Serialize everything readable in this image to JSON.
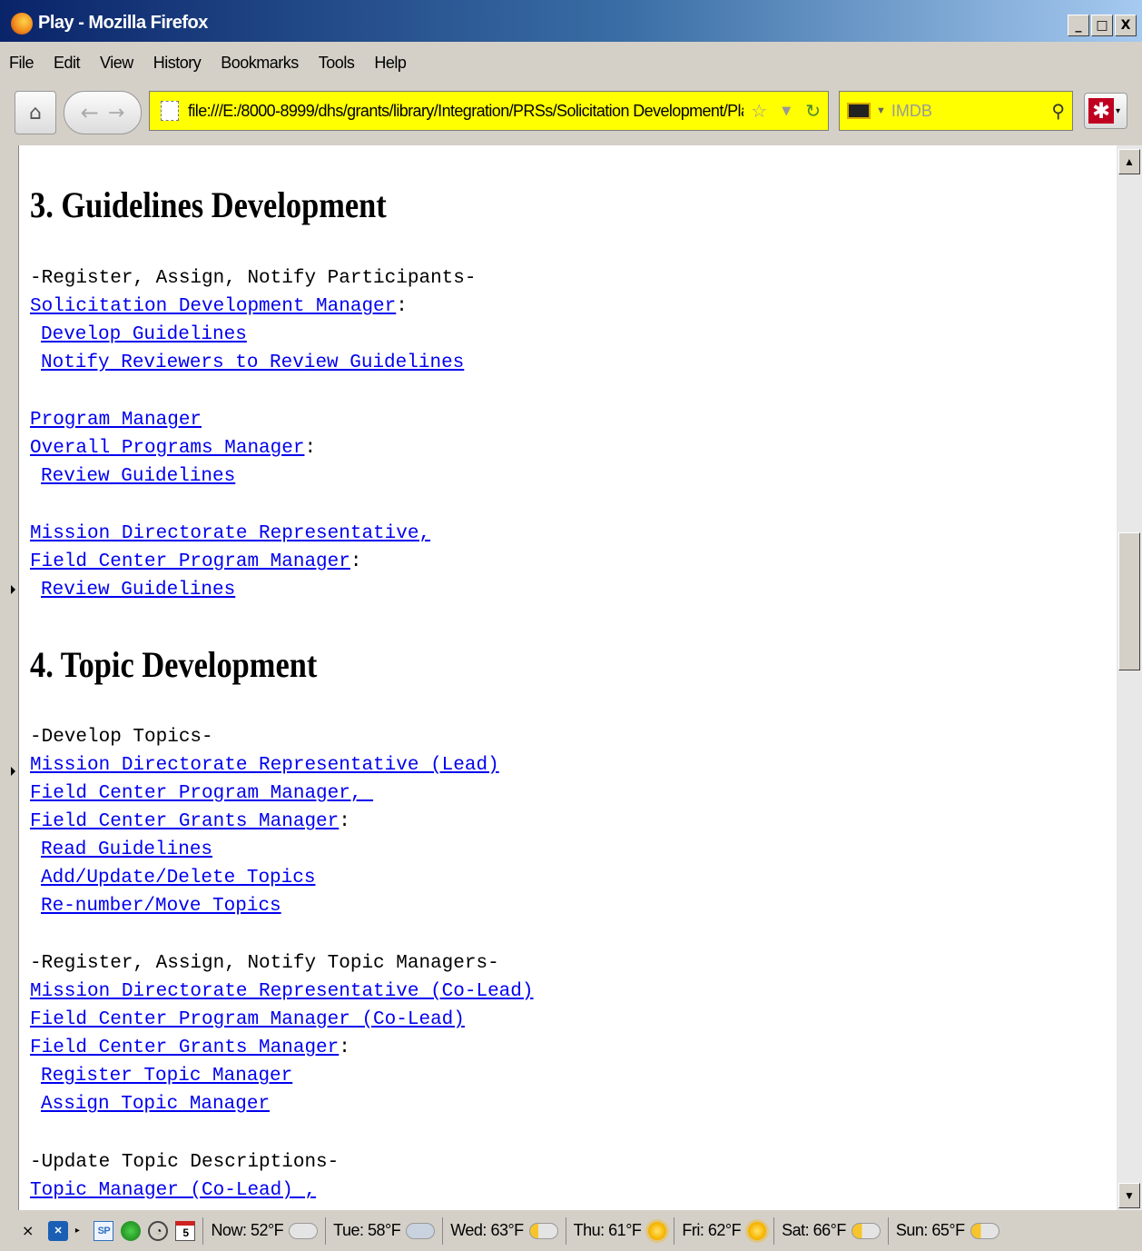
{
  "window": {
    "title": "Play - Mozilla Firefox",
    "buttons": [
      "_",
      "□",
      "X"
    ]
  },
  "menu": [
    "File",
    "Edit",
    "View",
    "History",
    "Bookmarks",
    "Tools",
    "Help"
  ],
  "nav": {
    "url": "file:///E:/8000-8999/dhs/grants/library/Integration/PRSs/Solicitation Development/Pla",
    "search_placeholder": "IMDB"
  },
  "doc": {
    "s3": {
      "heading": "3. Guidelines Development",
      "group1": {
        "label": "-Register, Assign, Notify Participants-",
        "role": "Solicitation Development Manager",
        "actions": [
          "Develop Guidelines",
          "Notify Reviewers to Review Guidelines"
        ]
      },
      "group2": {
        "role1": "Program Manager",
        "role2": "Overall Programs Manager",
        "actions": [
          "Review Guidelines"
        ]
      },
      "group3": {
        "role1": "Mission Directorate Representative,",
        "role2": "Field Center Program Manager",
        "actions": [
          "Review Guidelines"
        ]
      }
    },
    "s4": {
      "heading": "4. Topic Development",
      "group1": {
        "label": "-Develop Topics-",
        "roles": [
          "Mission Directorate Representative (Lead)",
          "Field Center Program Manager, ",
          "Field Center Grants Manager"
        ],
        "actions": [
          "Read Guidelines",
          "Add/Update/Delete Topics",
          "Re-number/Move Topics"
        ]
      },
      "group2": {
        "label": "-Register, Assign, Notify Topic Managers-",
        "roles": [
          "Mission Directorate Representative (Co-Lead)",
          "Field Center Program Manager (Co-Lead)",
          "Field Center Grants Manager"
        ],
        "actions": [
          "Register Topic Manager",
          "Assign Topic Manager"
        ]
      },
      "group3": {
        "label": "-Update Topic Descriptions-",
        "roles": [
          "Topic Manager (Co-Lead) ,"
        ]
      }
    }
  },
  "punct": {
    "colon": ":"
  },
  "status": {
    "close": "×",
    "sp": "SP",
    "calendar": "5",
    "weather": [
      "Now: 52°F",
      "Tue: 58°F",
      "Wed: 63°F",
      "Thu: 61°F",
      "Fri: 62°F",
      "Sat: 66°F",
      "Sun: 65°F"
    ]
  }
}
